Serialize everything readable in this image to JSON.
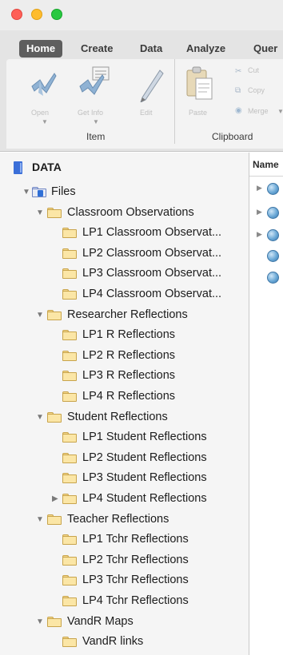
{
  "ribbon": {
    "tabs": [
      "Home",
      "Create",
      "Data",
      "Analyze",
      "Quer"
    ],
    "buttons": {
      "open": "Open",
      "get_info": "Get Info",
      "edit": "Edit",
      "paste": "Paste",
      "cut": "Cut",
      "copy": "Copy",
      "merge": "Merge"
    },
    "groups": {
      "item": "Item",
      "clipboard": "Clipboard"
    }
  },
  "tree": {
    "root": "DATA",
    "files_label": "Files",
    "classroom_observations": {
      "label": "Classroom Observations",
      "children": [
        "LP1 Classroom Observat...",
        "LP2 Classroom Observat...",
        "LP3 Classroom Observat...",
        "LP4 Classroom Observat..."
      ]
    },
    "researcher_reflections": {
      "label": "Researcher Reflections",
      "children": [
        "LP1 R Reflections",
        "LP2 R Reflections",
        "LP3 R Reflections",
        "LP4 R Reflections"
      ]
    },
    "student_reflections": {
      "label": "Student Reflections",
      "children": [
        "LP1 Student Reflections",
        "LP2 Student Reflections",
        "LP3 Student Reflections",
        "LP4 Student Reflections"
      ]
    },
    "teacher_reflections": {
      "label": "Teacher Reflections",
      "children": [
        "LP1 Tchr Reflections",
        "LP2 Tchr Reflections",
        "LP3 Tchr Reflections",
        "LP4 Tchr Reflections"
      ]
    },
    "vandr_maps": {
      "label": "VandR Maps",
      "children": [
        "VandR links"
      ]
    }
  },
  "list": {
    "column_header": "Name"
  },
  "colors": {
    "active_tab": "#5e5e5e",
    "folder": "#fbe6a6",
    "globe": "#6aa8d6",
    "root_icon": "#3b6fd8"
  }
}
